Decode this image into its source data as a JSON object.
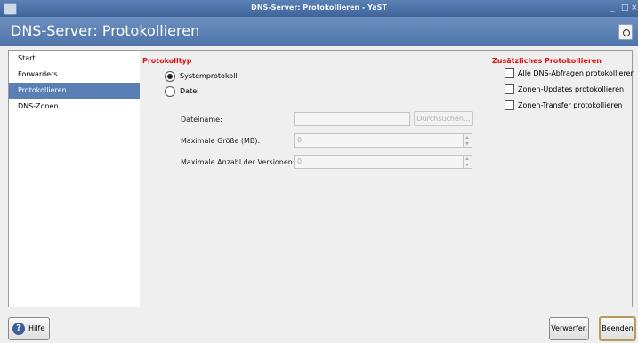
{
  "window": {
    "title": "DNS-Server: Protokollieren - YaST",
    "min_glyph": "_",
    "max_glyph": "□",
    "close_glyph": "×"
  },
  "header": {
    "title": "DNS-Server: Protokollieren"
  },
  "sidebar": {
    "items": [
      {
        "label": "Start",
        "active": false
      },
      {
        "label": "Forwarders",
        "active": false
      },
      {
        "label": "Protokollieren",
        "active": true
      },
      {
        "label": "DNS-Zonen",
        "active": false
      }
    ]
  },
  "logtype": {
    "heading": "Protokolltyp",
    "option_system": "Systemprotokoll",
    "option_file": "Datei",
    "selected": "Systemprotokoll"
  },
  "file": {
    "filename_label": "Dateiname:",
    "filename_value": "",
    "browse_label": "Durchsuchen...",
    "maxsize_label": "Maximale Größe (MB):",
    "maxsize_value": "0",
    "maxversions_label": "Maximale Anzahl der Versionen:",
    "maxversions_value": "0"
  },
  "extra": {
    "heading": "Zusätzliches Protokollieren",
    "opt_queries": "Alle DNS-Abfragen protokollieren",
    "opt_updates": "Zonen-Updates protokollieren",
    "opt_transfer": "Zonen-Transfer protokollieren"
  },
  "footer": {
    "help": "Hilfe",
    "help_icon": "?",
    "discard": "Verwerfen",
    "finish": "Beenden"
  },
  "colors": {
    "titlebar": "#4a6fa5",
    "sidebar_active": "#5a7fb7",
    "section_heading": "#e01010"
  }
}
